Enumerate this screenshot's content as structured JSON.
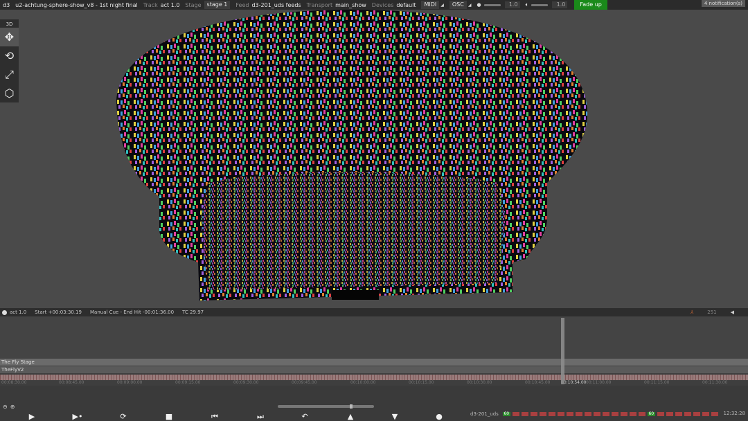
{
  "topbar": {
    "app": "d3",
    "project": "u2-achtung-sphere-show_v8 - 1st night final",
    "track_label": "Track",
    "track_value": "act 1.0",
    "stage_label": "Stage",
    "stage_value": "stage 1",
    "feed_label": "Feed",
    "feed_value": "d3-201_uds feeds",
    "transport_label": "Transport",
    "transport_value": "main_show",
    "devices_label": "Devices",
    "devices_value": "default",
    "midi": "MIDI",
    "osc": "OSC",
    "level1": "1.0",
    "level2": "1.0",
    "fade_up": "Fade up",
    "notifications": "4 notification(s)"
  },
  "tools": {
    "mode": "3D",
    "items": [
      {
        "name": "move",
        "icon": "move-arrows-icon"
      },
      {
        "name": "rotate",
        "icon": "rotate-icon"
      },
      {
        "name": "scale",
        "icon": "scale-icon"
      },
      {
        "name": "object",
        "icon": "cube-icon"
      }
    ]
  },
  "cue_row": {
    "track": "act 1.0",
    "start": "Start +00:03:30.19",
    "cue": "Manual Cue - End Hit -00:01:36.00",
    "tc": "TC 29.97",
    "right_value": "251"
  },
  "timeline": {
    "layers": [
      "The Fly Stage",
      "TheFlyV2"
    ],
    "time_labels": [
      "00:08:30.00",
      "00:08:45.00",
      "00:09:00.00",
      "00:09:15.00",
      "00:09:30.00",
      "00:09:45.00",
      "00:10:00.00",
      "00:10:15.00",
      "00:10:30.00",
      "00:10:45.00",
      "00:10:54.00",
      "00:11:00.00",
      "00:11:15.00",
      "00:11:30.00"
    ],
    "current_time": "00:10:54.00"
  },
  "feed_status": {
    "name": "d3-201_uds",
    "value_a": "60",
    "value_b": "60"
  },
  "clock": "12:32:28",
  "colors": {
    "fade_up": "#1a8a1a",
    "feed_ok": "#2a8a2a",
    "feed_err": "#a84040"
  }
}
